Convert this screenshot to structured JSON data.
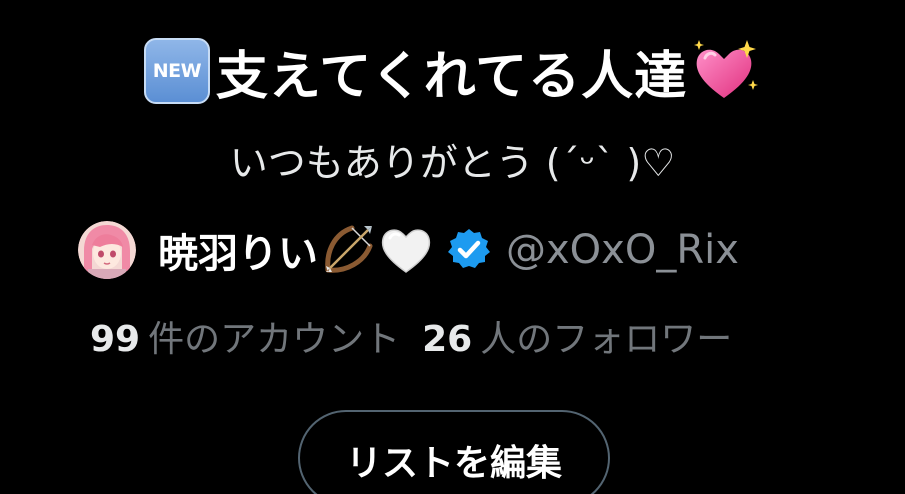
{
  "header": {
    "badge_label": "NEW",
    "badge_icon": "new-button-icon",
    "title": "支えてくれてる人達",
    "title_icon": "sparkling-heart-icon",
    "subtitle": "いつもありがとう (´ᵕ` )♡"
  },
  "owner": {
    "avatar_icon": "avatar",
    "name": "暁羽りい",
    "name_icons": [
      "bow-and-arrow-icon",
      "white-heart-icon"
    ],
    "verified_icon": "verified-badge-icon",
    "handle": "@xOxO_Rix"
  },
  "stats": {
    "members_count": "99",
    "members_label": "件のアカウント",
    "followers_count": "26",
    "followers_label": "人のフォロワー"
  },
  "actions": {
    "edit_label": "リストを編集"
  },
  "colors": {
    "background": "#000000",
    "primary_text": "#ffffff",
    "secondary_text": "#71767b",
    "verified_blue": "#1d9bf0",
    "button_border": "#536471"
  }
}
